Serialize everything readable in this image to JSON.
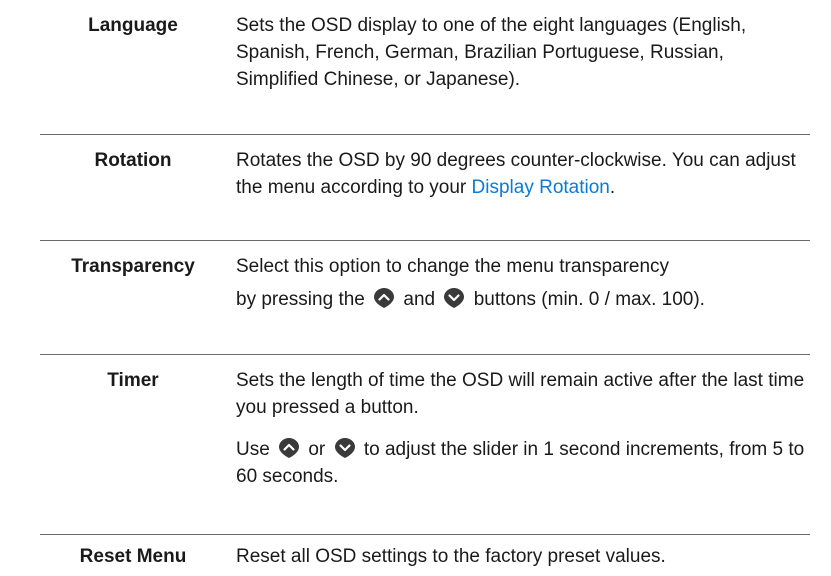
{
  "rows": [
    {
      "label": "Language",
      "text": "Sets the OSD display to one of the eight languages (English, Spanish, French, German, Brazilian Portuguese, Russian, Simplified Chinese, or Japanese)."
    },
    {
      "label": "Rotation",
      "text_before_link": "Rotates the OSD by 90 degrees counter-clockwise. You can adjust the menu according to your ",
      "link": "Display Rotation",
      "text_after_link": "."
    },
    {
      "label": "Transparency",
      "line1": "Select this option to change the menu transparency",
      "before_up": "by pressing the",
      "between": "and",
      "after_down": "buttons (min. 0 / max. 100).",
      "icons": [
        "chevron-up-icon",
        "chevron-down-icon"
      ]
    },
    {
      "label": "Timer",
      "para1": "Sets the length of time the OSD will remain active after the last time you pressed a button.",
      "before_up": "Use",
      "between": "or",
      "after_down": "to adjust the slider in 1 second increments, from 5 to 60 seconds.",
      "icons": [
        "chevron-up-icon",
        "chevron-down-icon"
      ]
    },
    {
      "label": "Reset Menu",
      "text": "Reset all OSD settings to the factory preset values."
    }
  ],
  "colors": {
    "link": "#0a7bd6",
    "divider": "#6b6b6b",
    "icon": "#3a3a3a"
  }
}
